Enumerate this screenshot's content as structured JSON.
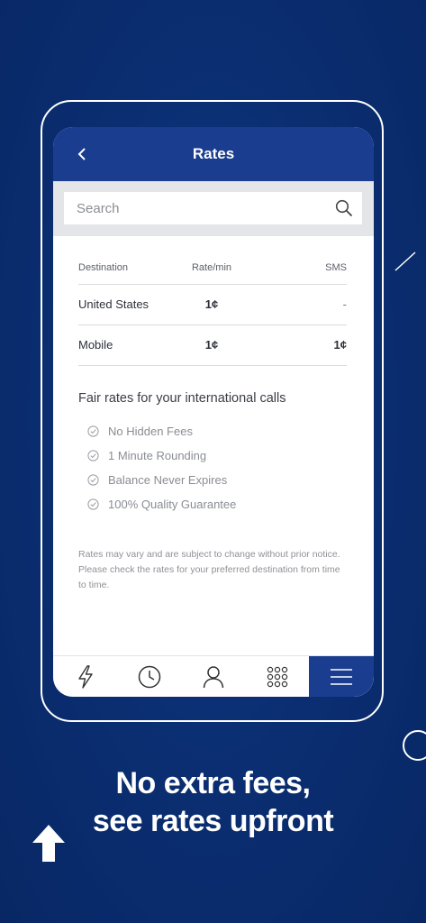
{
  "app": {
    "title": "Rates"
  },
  "search": {
    "placeholder": "Search"
  },
  "table": {
    "headers": [
      "Destination",
      "Rate/min",
      "SMS"
    ],
    "rows": [
      {
        "destination": "United States",
        "rate": "1¢",
        "sms": "-"
      },
      {
        "destination": "Mobile",
        "rate": "1¢",
        "sms": "1¢"
      }
    ]
  },
  "fair": {
    "title": "Fair rates for your international calls",
    "features": [
      "No Hidden Fees",
      "1 Minute Rounding",
      "Balance Never Expires",
      "100% Quality Guarantee"
    ]
  },
  "disclaimer": "Rates may vary and are subject to change without prior notice. Please check the rates for your preferred destination from time to time.",
  "nav": {
    "items": [
      {
        "icon": "lightning-icon",
        "active": false
      },
      {
        "icon": "clock-icon",
        "active": false
      },
      {
        "icon": "user-icon",
        "active": false
      },
      {
        "icon": "keypad-icon",
        "active": false
      },
      {
        "icon": "menu-icon",
        "active": true
      }
    ]
  },
  "promo": {
    "line1": "No extra fees,",
    "line2": "see rates upfront"
  },
  "colors": {
    "brand": "#1a3d8f",
    "background": "#0b2f73"
  }
}
